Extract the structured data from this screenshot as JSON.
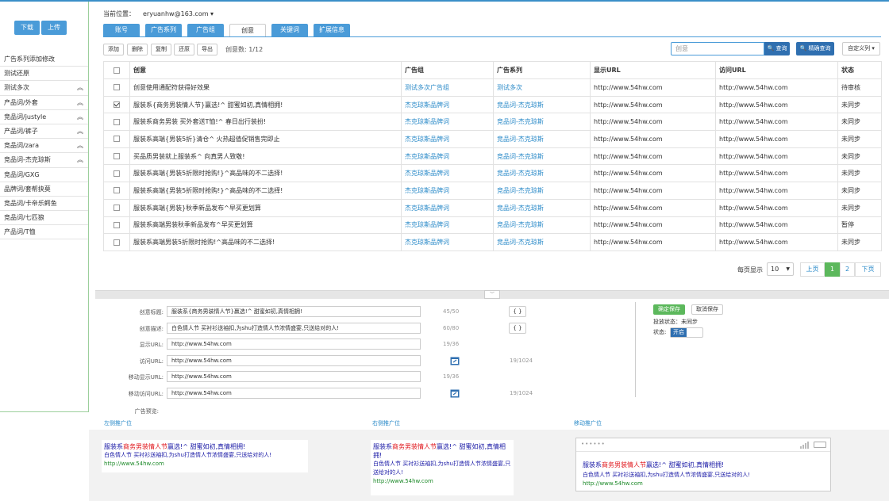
{
  "sidebar": {
    "buttons": {
      "download": "下载",
      "upload": "上传"
    },
    "items": [
      {
        "label": "广告系列添加修改",
        "chev": ""
      },
      {
        "label": "测试还原",
        "chev": ""
      },
      {
        "label": "测试多次",
        "chev": "︽"
      },
      {
        "label": "产品词/外套",
        "chev": "︽"
      },
      {
        "label": "竞品词/justyle",
        "chev": "︽"
      },
      {
        "label": "产品词/裤子",
        "chev": "︽"
      },
      {
        "label": "竞品词/zara",
        "chev": "︽"
      },
      {
        "label": "竞品词-杰克琼斯",
        "chev": "︽"
      },
      {
        "label": "竞品词/GXG",
        "chev": ""
      },
      {
        "label": "品牌词/套帮抉莫",
        "chev": ""
      },
      {
        "label": "竞品词/卡帝乐鳄鱼",
        "chev": ""
      },
      {
        "label": "竞品词/七匹狼",
        "chev": ""
      },
      {
        "label": "产品词/T恤",
        "chev": ""
      }
    ]
  },
  "header": {
    "location_label": "当前位置：",
    "account": "eryuanhw@163.com ▾"
  },
  "tabs": [
    "账号",
    "广告系列",
    "广告组",
    "创意",
    "关键词",
    "扩展信息"
  ],
  "toolbar": {
    "add": "添加",
    "delete": "删除",
    "copy": "复制",
    "restore": "还原",
    "export": "导出",
    "count": "创意数: 1/12",
    "search_placeholder": "创意",
    "search_btn": "🔍 查询",
    "exact_btn": "🔍 精确查询",
    "custom_btn": "自定义列 ▾"
  },
  "table": {
    "headers": {
      "creative": "创意",
      "adgroup": "广告组",
      "campaign": "广告系列",
      "display_url": "显示URL",
      "visit_url": "访问URL",
      "status": "状态"
    },
    "rows": [
      {
        "checked": false,
        "creative": "创意使用通配符获得好效果",
        "adgroup": "测试多次广告组",
        "campaign": "测试多次",
        "display_url": "http://www.54hw.com",
        "visit_url": "http://www.54hw.com",
        "status": "待审核"
      },
      {
        "checked": true,
        "creative": "服装系{商务男装情人节}赢选!^ 甜蜜如初,真情相拥!",
        "adgroup": "杰克琼斯品牌词",
        "campaign": "竞品词-杰克琼斯",
        "display_url": "http://www.54hw.com",
        "visit_url": "http://www.54hw.com",
        "status": "未同步"
      },
      {
        "checked": false,
        "creative": "服装系商务男装 买外套送T恤!^ 春日出行装扮!",
        "adgroup": "杰克琼斯品牌词",
        "campaign": "竞品词-杰克琼斯",
        "display_url": "http://www.54hw.com",
        "visit_url": "http://www.54hw.com",
        "status": "未同步"
      },
      {
        "checked": false,
        "creative": "服装系高端{男装5折}清仓^ 火热超值促销售完即止",
        "adgroup": "杰克琼斯品牌词",
        "campaign": "竞品词-杰克琼斯",
        "display_url": "http://www.54hw.com",
        "visit_url": "http://www.54hw.com",
        "status": "未同步"
      },
      {
        "checked": false,
        "creative": "买品质男装就上服装系^ 向真男人致敬!",
        "adgroup": "杰克琼斯品牌词",
        "campaign": "竞品词-杰克琼斯",
        "display_url": "http://www.54hw.com",
        "visit_url": "http://www.54hw.com",
        "status": "未同步"
      },
      {
        "checked": false,
        "creative": "服装系高端{男装5折限时抢购!}^高品味的不二选择!",
        "adgroup": "杰克琼斯品牌词",
        "campaign": "竞品词-杰克琼斯",
        "display_url": "http://www.54hw.com",
        "visit_url": "http://www.54hw.com",
        "status": "未同步"
      },
      {
        "checked": false,
        "creative": "服装系高端{男装5折限时抢购!}^高品味的不二选择!",
        "adgroup": "杰克琼斯品牌词",
        "campaign": "竞品词-杰克琼斯",
        "display_url": "http://www.54hw.com",
        "visit_url": "http://www.54hw.com",
        "status": "未同步"
      },
      {
        "checked": false,
        "creative": "服装系高端{男装}秋季新品发布^早买更划算",
        "adgroup": "杰克琼斯品牌词",
        "campaign": "竞品词-杰克琼斯",
        "display_url": "http://www.54hw.com",
        "visit_url": "http://www.54hw.com",
        "status": "未同步"
      },
      {
        "checked": false,
        "creative": "服装系高端男装秋季新品发布^早买更划算",
        "adgroup": "杰克琼斯品牌词",
        "campaign": "竞品词-杰克琼斯",
        "display_url": "http://www.54hw.com",
        "visit_url": "http://www.54hw.com",
        "status": "暂停"
      },
      {
        "checked": false,
        "creative": "服装系高端男装5折限时抢购!^高品味的不二选择!",
        "adgroup": "杰克琼斯品牌词",
        "campaign": "竞品词-杰克琼斯",
        "display_url": "http://www.54hw.com",
        "visit_url": "http://www.54hw.com",
        "status": "未同步"
      }
    ]
  },
  "pagination": {
    "per_page_label": "每页显示",
    "per_page": "10",
    "prev": "上页",
    "pages": [
      "1",
      "2"
    ],
    "next": "下页"
  },
  "splitter_icon": "﹀",
  "form": {
    "fields": [
      {
        "label": "创意标题:",
        "value": "服装系{商务男装情人节}赢选!^ 甜蜜如初,真情相拥!",
        "count": "45/50",
        "bracket": "{ }"
      },
      {
        "label": "创意描述:",
        "value": "白色情人节 买衬衫送袖扣,为shu打造情人节浓情盛宴,只送给对的人!",
        "count": "60/80",
        "bracket": "{ }"
      },
      {
        "label": "显示URL:",
        "value": "http://www.54hw.com",
        "count": "19/36"
      },
      {
        "label": "访问URL:",
        "value": "http://www.54hw.com",
        "count": "19/1024"
      },
      {
        "label": "移动显示URL:",
        "value": "http://www.54hw.com",
        "count": "19/36"
      },
      {
        "label": "移动访问URL:",
        "value": "http://www.54hw.com",
        "count": "19/1024"
      }
    ],
    "preview_label": "广告预览:",
    "save": "确定保存",
    "cancel": "取消保存",
    "sync_status": "投放状态：未同步",
    "status_label": "状态:",
    "toggle_on": "开启"
  },
  "previews": {
    "left_title": "左侧推广位",
    "right_title": "右侧推广位",
    "mobile_title": "移动推广位",
    "ad": {
      "title_prefix": "服装系",
      "title_highlight": "商务男装情人节",
      "title_suffix": "赢选!^ 甜蜜如初,真情相拥!",
      "desc": "白色情人节 买衬衫送袖扣,为shu打造情人节浓情盛宴,只送给对的人!",
      "url": "http://www.54hw.com"
    },
    "right_ad": {
      "title_prefix": "服装系",
      "title_highlight": "商务男装情人节",
      "title_suffix": "赢选!^ 甜蜜如初,真情相拥!",
      "desc": "白色情人节 买衬衫送袖扣,为shu打造情人节浓情盛宴,只送给对的人!",
      "url": "http://www.54hw.com"
    },
    "mobile_dots": "••••••"
  },
  "colors": {
    "accent": "#4a9bd8",
    "link": "#2a8ac8",
    "save_green": "#5cb85c",
    "ad_title_red": "#e0161b"
  }
}
